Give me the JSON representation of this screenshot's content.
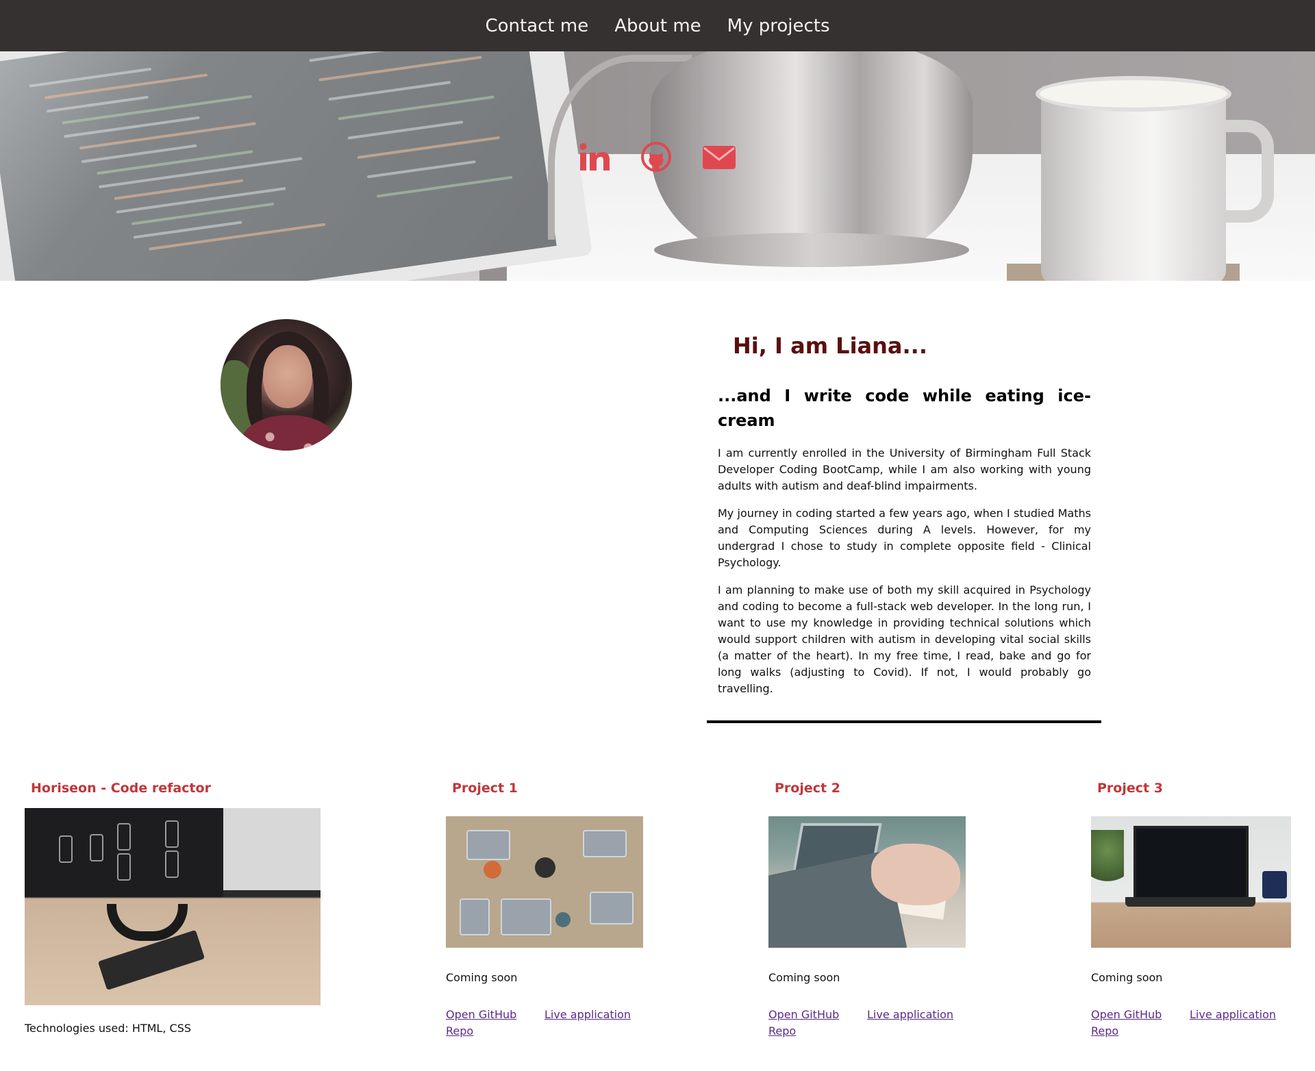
{
  "nav": {
    "items": [
      {
        "label": "Contact me"
      },
      {
        "label": "About me"
      },
      {
        "label": "My projects"
      }
    ]
  },
  "hero": {
    "social_icons": [
      "linkedin-icon",
      "github-icon",
      "envelope-icon"
    ],
    "icon_color": "#e0484f"
  },
  "about": {
    "heading": "Hi, I am Liana...",
    "subheading": "...and I write code while eating ice-cream",
    "paragraphs": [
      "I am currently enrolled in the University of Birmingham Full Stack Developer Coding BootCamp, while I am also working with young adults with autism and deaf-blind impairments.",
      "My journey in coding started a few years ago, when I studied Maths and Computing Sciences during A levels. However, for my undergrad I chose to study in complete opposite field - Clinical Psychology.",
      "I am planning to make use of both my skill acquired in Psychology and coding to become a full-stack web developer. In the long run, I want to use my knowledge in providing technical solutions which would support children with autism in developing vital social skills (a matter of the heart). In my free time, I read, bake and go for long walks (adjusting to Covid). If not, I would probably go travelling."
    ]
  },
  "projects": [
    {
      "title": "Horiseon - Code refactor",
      "note": "Technologies used: HTML, CSS"
    },
    {
      "title": "Project 1",
      "note": "Coming soon",
      "link_repo": "Open GitHub Repo",
      "link_live": "Live application"
    },
    {
      "title": "Project 2",
      "note": "Coming soon",
      "link_repo": "Open GitHub Repo",
      "link_live": "Live application"
    },
    {
      "title": "Project 3",
      "note": "Coming soon",
      "link_repo": "Open GitHub Repo",
      "link_live": "Live application"
    }
  ],
  "colors": {
    "nav_bg": "#353131",
    "heading": "#5a0f0f",
    "project_title": "#c0363a",
    "link": "#5a2a8a"
  }
}
